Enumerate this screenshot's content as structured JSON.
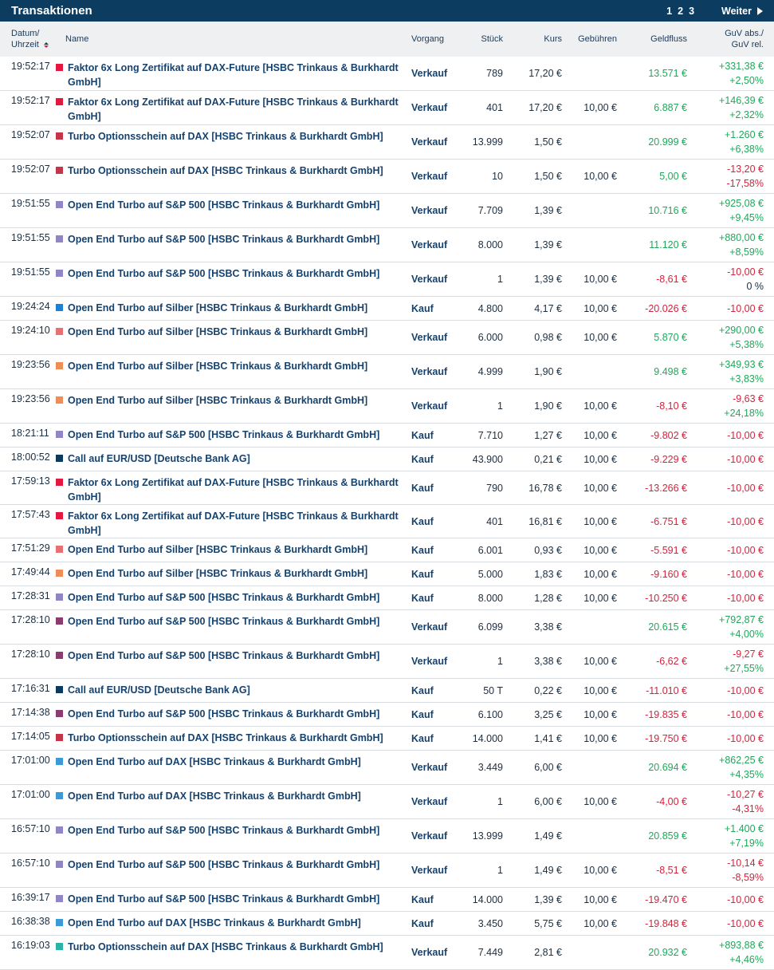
{
  "header": {
    "title": "Transaktionen",
    "pages": [
      "1",
      "2",
      "3"
    ],
    "next": "Weiter"
  },
  "columns": {
    "datum": "Datum/",
    "uhrzeit": "Uhrzeit",
    "name": "Name",
    "vorgang": "Vorgang",
    "stueck": "Stück",
    "kurs": "Kurs",
    "gebuehren": "Gebühren",
    "geldfluss": "Geldfluss",
    "guv_abs": "GuV abs./",
    "guv_rel": "GuV rel."
  },
  "rows": [
    {
      "time": "19:52:17",
      "color": "#e3173f",
      "name": "Faktor 6x Long Zertifikat auf DAX-Future [HSBC Trinkaus & Burkhardt GmbH]",
      "vorgang": "Verkauf",
      "stueck": "789",
      "stueck_faded": true,
      "kurs": "17,20 €",
      "gebuehren": "",
      "geldfluss": "13.571 €",
      "gf_sign": "pos",
      "guv_abs": "+331,38 €",
      "abs_sign": "pos",
      "guv_rel": "+2,50%",
      "rel_sign": "pos"
    },
    {
      "time": "19:52:17",
      "color": "#e3173f",
      "name": "Faktor 6x Long Zertifikat auf DAX-Future [HSBC Trinkaus & Burkhardt GmbH]",
      "vorgang": "Verkauf",
      "stueck": "401",
      "stueck_faded": true,
      "kurs": "17,20 €",
      "gebuehren": "10,00 €",
      "geldfluss": "6.887 €",
      "gf_sign": "pos",
      "guv_abs": "+146,39 €",
      "abs_sign": "pos",
      "guv_rel": "+2,32%",
      "rel_sign": "pos"
    },
    {
      "time": "19:52:07",
      "color": "#c33548",
      "name": "Turbo Optionsschein auf DAX [HSBC Trinkaus & Burkhardt GmbH]",
      "vorgang": "Verkauf",
      "stueck": "13.999",
      "stueck_faded": true,
      "kurs": "1,50 €",
      "gebuehren": "",
      "geldfluss": "20.999 €",
      "gf_sign": "pos",
      "guv_abs": "+1.260 €",
      "abs_sign": "pos",
      "guv_rel": "+6,38%",
      "rel_sign": "pos"
    },
    {
      "time": "19:52:07",
      "color": "#c33548",
      "name": "Turbo Optionsschein auf DAX [HSBC Trinkaus & Burkhardt GmbH]",
      "vorgang": "Verkauf",
      "stueck": "10",
      "stueck_faded": true,
      "kurs": "1,50 €",
      "gebuehren": "10,00 €",
      "geldfluss": "5,00 €",
      "gf_sign": "pos",
      "guv_abs": "-13,20 €",
      "abs_sign": "neg",
      "guv_rel": "-17,58%",
      "rel_sign": "neg"
    },
    {
      "time": "19:51:55",
      "color": "#8e87c4",
      "name": "Open End Turbo auf S&P 500 [HSBC Trinkaus & Burkhardt GmbH]",
      "vorgang": "Verkauf",
      "stueck": "7.709",
      "stueck_faded": true,
      "kurs": "1,39 €",
      "gebuehren": "",
      "geldfluss": "10.716 €",
      "gf_sign": "pos",
      "guv_abs": "+925,08 €",
      "abs_sign": "pos",
      "guv_rel": "+9,45%",
      "rel_sign": "pos"
    },
    {
      "time": "19:51:55",
      "color": "#8e87c4",
      "name": "Open End Turbo auf S&P 500 [HSBC Trinkaus & Burkhardt GmbH]",
      "vorgang": "Verkauf",
      "stueck": "8.000",
      "stueck_faded": true,
      "kurs": "1,39 €",
      "gebuehren": "",
      "geldfluss": "11.120 €",
      "gf_sign": "pos",
      "guv_abs": "+880,00 €",
      "abs_sign": "pos",
      "guv_rel": "+8,59%",
      "rel_sign": "pos"
    },
    {
      "time": "19:51:55",
      "color": "#8e87c4",
      "name": "Open End Turbo auf S&P 500 [HSBC Trinkaus & Burkhardt GmbH]",
      "vorgang": "Verkauf",
      "stueck": "1",
      "stueck_faded": true,
      "kurs": "1,39 €",
      "gebuehren": "10,00 €",
      "geldfluss": "-8,61 €",
      "gf_sign": "neg",
      "guv_abs": "-10,00 €",
      "abs_sign": "neg",
      "guv_rel": "0 %",
      "rel_sign": "neutral"
    },
    {
      "time": "19:24:24",
      "color": "#1d7fd6",
      "name": "Open End Turbo auf Silber [HSBC Trinkaus & Burkhardt GmbH]",
      "vorgang": "Kauf",
      "stueck": "4.800",
      "stueck_faded": false,
      "kurs": "4,17 €",
      "gebuehren": "10,00 €",
      "geldfluss": "-20.026 €",
      "gf_sign": "neg",
      "guv_abs": "-10,00 €",
      "abs_sign": "neg",
      "guv_rel": "",
      "rel_sign": "neutral"
    },
    {
      "time": "19:24:10",
      "color": "#e86f73",
      "name": "Open End Turbo auf Silber [HSBC Trinkaus & Burkhardt GmbH]",
      "vorgang": "Verkauf",
      "stueck": "6.000",
      "stueck_faded": true,
      "kurs": "0,98 €",
      "gebuehren": "10,00 €",
      "geldfluss": "5.870 €",
      "gf_sign": "pos",
      "guv_abs": "+290,00 €",
      "abs_sign": "pos",
      "guv_rel": "+5,38%",
      "rel_sign": "pos"
    },
    {
      "time": "19:23:56",
      "color": "#f08c55",
      "name": "Open End Turbo auf Silber [HSBC Trinkaus & Burkhardt GmbH]",
      "vorgang": "Verkauf",
      "stueck": "4.999",
      "stueck_faded": true,
      "kurs": "1,90 €",
      "gebuehren": "",
      "geldfluss": "9.498 €",
      "gf_sign": "pos",
      "guv_abs": "+349,93 €",
      "abs_sign": "pos",
      "guv_rel": "+3,83%",
      "rel_sign": "pos"
    },
    {
      "time": "19:23:56",
      "color": "#f08c55",
      "name": "Open End Turbo auf Silber [HSBC Trinkaus & Burkhardt GmbH]",
      "vorgang": "Verkauf",
      "stueck": "1",
      "stueck_faded": true,
      "kurs": "1,90 €",
      "gebuehren": "10,00 €",
      "geldfluss": "-8,10 €",
      "gf_sign": "neg",
      "guv_abs": "-9,63 €",
      "abs_sign": "neg",
      "guv_rel": "+24,18%",
      "rel_sign": "pos"
    },
    {
      "time": "18:21:11",
      "color": "#8e87c4",
      "name": "Open End Turbo auf S&P 500 [HSBC Trinkaus & Burkhardt GmbH]",
      "vorgang": "Kauf",
      "stueck": "7.710",
      "stueck_faded": false,
      "kurs": "1,27 €",
      "gebuehren": "10,00 €",
      "geldfluss": "-9.802 €",
      "gf_sign": "neg",
      "guv_abs": "-10,00 €",
      "abs_sign": "neg",
      "guv_rel": "",
      "rel_sign": "neutral"
    },
    {
      "time": "18:00:52",
      "color": "#0d3a5c",
      "name": "Call auf EUR/USD [Deutsche Bank AG]",
      "vorgang": "Kauf",
      "stueck": "43.900",
      "stueck_faded": false,
      "kurs": "0,21 €",
      "gebuehren": "10,00 €",
      "geldfluss": "-9.229 €",
      "gf_sign": "neg",
      "guv_abs": "-10,00 €",
      "abs_sign": "neg",
      "guv_rel": "",
      "rel_sign": "neutral"
    },
    {
      "time": "17:59:13",
      "color": "#e3173f",
      "name": "Faktor 6x Long Zertifikat auf DAX-Future [HSBC Trinkaus & Burkhardt GmbH]",
      "vorgang": "Kauf",
      "stueck": "790",
      "stueck_faded": false,
      "kurs": "16,78 €",
      "gebuehren": "10,00 €",
      "geldfluss": "-13.266 €",
      "gf_sign": "neg",
      "guv_abs": "-10,00 €",
      "abs_sign": "neg",
      "guv_rel": "",
      "rel_sign": "neutral"
    },
    {
      "time": "17:57:43",
      "color": "#e3173f",
      "name": "Faktor 6x Long Zertifikat auf DAX-Future [HSBC Trinkaus & Burkhardt GmbH]",
      "vorgang": "Kauf",
      "stueck": "401",
      "stueck_faded": true,
      "kurs": "16,81 €",
      "gebuehren": "10,00 €",
      "geldfluss": "-6.751 €",
      "gf_sign": "neg",
      "guv_abs": "-10,00 €",
      "abs_sign": "neg",
      "guv_rel": "",
      "rel_sign": "neutral"
    },
    {
      "time": "17:51:29",
      "color": "#e86f73",
      "name": "Open End Turbo auf Silber [HSBC Trinkaus & Burkhardt GmbH]",
      "vorgang": "Kauf",
      "stueck": "6.001",
      "stueck_faded": false,
      "kurs": "0,93 €",
      "gebuehren": "10,00 €",
      "geldfluss": "-5.591 €",
      "gf_sign": "neg",
      "guv_abs": "-10,00 €",
      "abs_sign": "neg",
      "guv_rel": "",
      "rel_sign": "neutral"
    },
    {
      "time": "17:49:44",
      "color": "#f08c55",
      "name": "Open End Turbo auf Silber [HSBC Trinkaus & Burkhardt GmbH]",
      "vorgang": "Kauf",
      "stueck": "5.000",
      "stueck_faded": false,
      "kurs": "1,83 €",
      "gebuehren": "10,00 €",
      "geldfluss": "-9.160 €",
      "gf_sign": "neg",
      "guv_abs": "-10,00 €",
      "abs_sign": "neg",
      "guv_rel": "",
      "rel_sign": "neutral"
    },
    {
      "time": "17:28:31",
      "color": "#8e87c4",
      "name": "Open End Turbo auf S&P 500 [HSBC Trinkaus & Burkhardt GmbH]",
      "vorgang": "Kauf",
      "stueck": "8.000",
      "stueck_faded": true,
      "kurs": "1,28 €",
      "gebuehren": "10,00 €",
      "geldfluss": "-10.250 €",
      "gf_sign": "neg",
      "guv_abs": "-10,00 €",
      "abs_sign": "neg",
      "guv_rel": "",
      "rel_sign": "neutral"
    },
    {
      "time": "17:28:10",
      "color": "#8b3c6e",
      "name": "Open End Turbo auf S&P 500 [HSBC Trinkaus & Burkhardt GmbH]",
      "vorgang": "Verkauf",
      "stueck": "6.099",
      "stueck_faded": true,
      "kurs": "3,38 €",
      "gebuehren": "",
      "geldfluss": "20.615 €",
      "gf_sign": "pos",
      "guv_abs": "+792,87 €",
      "abs_sign": "pos",
      "guv_rel": "+4,00%",
      "rel_sign": "pos"
    },
    {
      "time": "17:28:10",
      "color": "#8b3c6e",
      "name": "Open End Turbo auf S&P 500 [HSBC Trinkaus & Burkhardt GmbH]",
      "vorgang": "Verkauf",
      "stueck": "1",
      "stueck_faded": true,
      "kurs": "3,38 €",
      "gebuehren": "10,00 €",
      "geldfluss": "-6,62 €",
      "gf_sign": "neg",
      "guv_abs": "-9,27 €",
      "abs_sign": "neg",
      "guv_rel": "+27,55%",
      "rel_sign": "pos"
    },
    {
      "time": "17:16:31",
      "color": "#0d3a5c",
      "name": "Call auf EUR/USD [Deutsche Bank AG]",
      "vorgang": "Kauf",
      "stueck": "50 T",
      "stueck_faded": false,
      "kurs": "0,22 €",
      "gebuehren": "10,00 €",
      "geldfluss": "-11.010 €",
      "gf_sign": "neg",
      "guv_abs": "-10,00 €",
      "abs_sign": "neg",
      "guv_rel": "",
      "rel_sign": "neutral"
    },
    {
      "time": "17:14:38",
      "color": "#8b3c6e",
      "name": "Open End Turbo auf S&P 500 [HSBC Trinkaus & Burkhardt GmbH]",
      "vorgang": "Kauf",
      "stueck": "6.100",
      "stueck_faded": false,
      "kurs": "3,25 €",
      "gebuehren": "10,00 €",
      "geldfluss": "-19.835 €",
      "gf_sign": "neg",
      "guv_abs": "-10,00 €",
      "abs_sign": "neg",
      "guv_rel": "",
      "rel_sign": "neutral"
    },
    {
      "time": "17:14:05",
      "color": "#c33548",
      "name": "Turbo Optionsschein auf DAX [HSBC Trinkaus & Burkhardt GmbH]",
      "vorgang": "Kauf",
      "stueck": "14.000",
      "stueck_faded": false,
      "kurs": "1,41 €",
      "gebuehren": "10,00 €",
      "geldfluss": "-19.750 €",
      "gf_sign": "neg",
      "guv_abs": "-10,00 €",
      "abs_sign": "neg",
      "guv_rel": "",
      "rel_sign": "neutral"
    },
    {
      "time": "17:01:00",
      "color": "#3d9ad8",
      "name": "Open End Turbo auf DAX [HSBC Trinkaus & Burkhardt GmbH]",
      "vorgang": "Verkauf",
      "stueck": "3.449",
      "stueck_faded": true,
      "kurs": "6,00 €",
      "gebuehren": "",
      "geldfluss": "20.694 €",
      "gf_sign": "pos",
      "guv_abs": "+862,25 €",
      "abs_sign": "pos",
      "guv_rel": "+4,35%",
      "rel_sign": "pos"
    },
    {
      "time": "17:01:00",
      "color": "#3d9ad8",
      "name": "Open End Turbo auf DAX [HSBC Trinkaus & Burkhardt GmbH]",
      "vorgang": "Verkauf",
      "stueck": "1",
      "stueck_faded": true,
      "kurs": "6,00 €",
      "gebuehren": "10,00 €",
      "geldfluss": "-4,00 €",
      "gf_sign": "neg",
      "guv_abs": "-10,27 €",
      "abs_sign": "neg",
      "guv_rel": "-4,31%",
      "rel_sign": "neg"
    },
    {
      "time": "16:57:10",
      "color": "#8e87c4",
      "name": "Open End Turbo auf S&P 500 [HSBC Trinkaus & Burkhardt GmbH]",
      "vorgang": "Verkauf",
      "stueck": "13.999",
      "stueck_faded": true,
      "kurs": "1,49 €",
      "gebuehren": "",
      "geldfluss": "20.859 €",
      "gf_sign": "pos",
      "guv_abs": "+1.400 €",
      "abs_sign": "pos",
      "guv_rel": "+7,19%",
      "rel_sign": "pos"
    },
    {
      "time": "16:57:10",
      "color": "#8e87c4",
      "name": "Open End Turbo auf S&P 500 [HSBC Trinkaus & Burkhardt GmbH]",
      "vorgang": "Verkauf",
      "stueck": "1",
      "stueck_faded": true,
      "kurs": "1,49 €",
      "gebuehren": "10,00 €",
      "geldfluss": "-8,51 €",
      "gf_sign": "neg",
      "guv_abs": "-10,14 €",
      "abs_sign": "neg",
      "guv_rel": "-8,59%",
      "rel_sign": "neg"
    },
    {
      "time": "16:39:17",
      "color": "#8e87c4",
      "name": "Open End Turbo auf S&P 500 [HSBC Trinkaus & Burkhardt GmbH]",
      "vorgang": "Kauf",
      "stueck": "14.000",
      "stueck_faded": true,
      "kurs": "1,39 €",
      "gebuehren": "10,00 €",
      "geldfluss": "-19.470 €",
      "gf_sign": "neg",
      "guv_abs": "-10,00 €",
      "abs_sign": "neg",
      "guv_rel": "",
      "rel_sign": "neutral"
    },
    {
      "time": "16:38:38",
      "color": "#3d9ad8",
      "name": "Open End Turbo auf DAX [HSBC Trinkaus & Burkhardt GmbH]",
      "vorgang": "Kauf",
      "stueck": "3.450",
      "stueck_faded": false,
      "kurs": "5,75 €",
      "gebuehren": "10,00 €",
      "geldfluss": "-19.848 €",
      "gf_sign": "neg",
      "guv_abs": "-10,00 €",
      "abs_sign": "neg",
      "guv_rel": "",
      "rel_sign": "neutral"
    },
    {
      "time": "16:19:03",
      "color": "#2bb3a5",
      "name": "Turbo Optionsschein auf DAX [HSBC Trinkaus & Burkhardt GmbH]",
      "vorgang": "Verkauf",
      "stueck": "7.449",
      "stueck_faded": true,
      "kurs": "2,81 €",
      "gebuehren": "",
      "geldfluss": "20.932 €",
      "gf_sign": "pos",
      "guv_abs": "+893,88 €",
      "abs_sign": "pos",
      "guv_rel": "+4,46%",
      "rel_sign": "pos"
    }
  ]
}
